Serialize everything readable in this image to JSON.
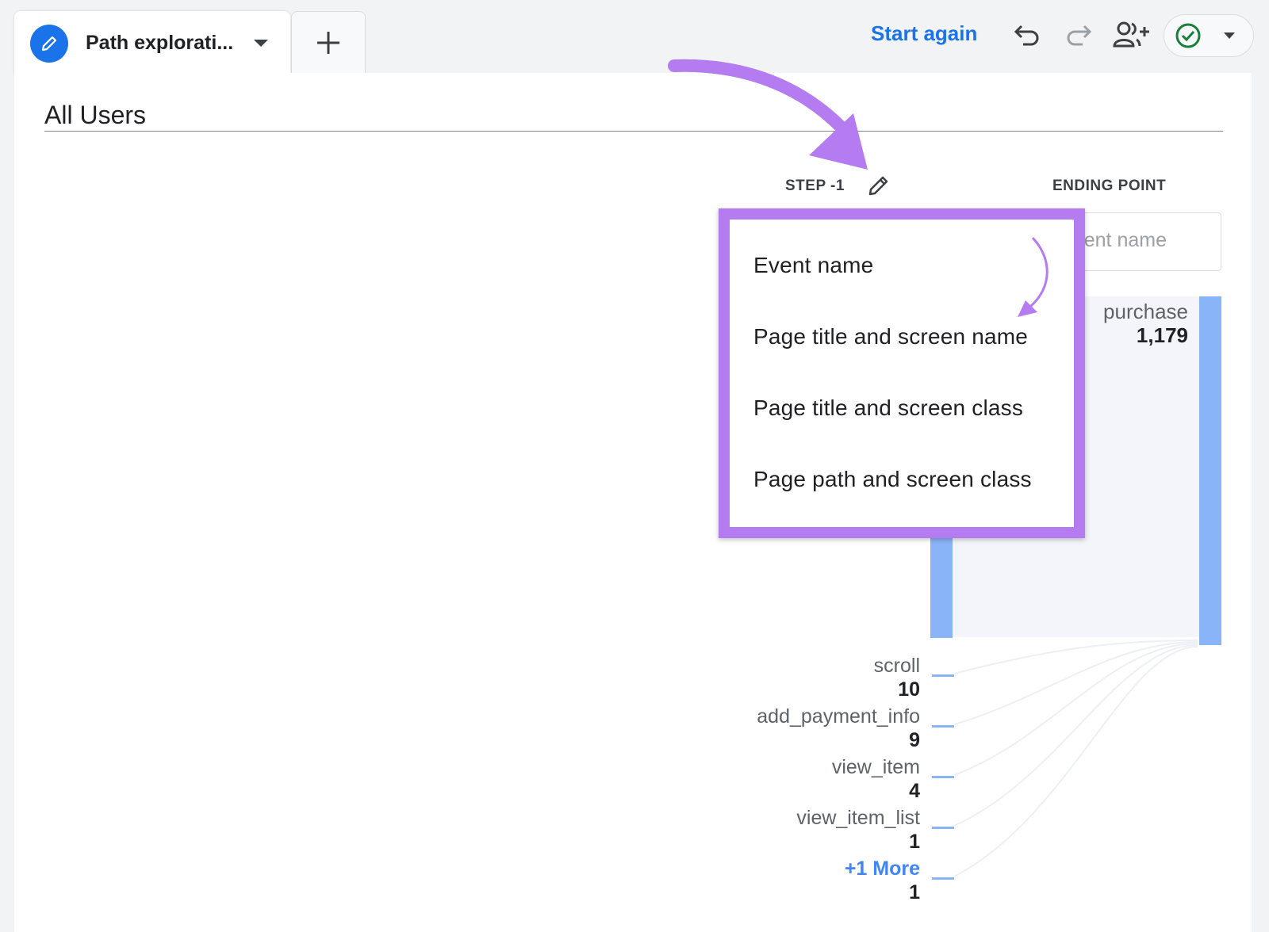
{
  "tab": {
    "label": "Path explorati...",
    "edit_icon": "pencil-icon",
    "caret_icon": "caret-down-icon"
  },
  "add_tab": {
    "icon": "plus-icon"
  },
  "toolbar": {
    "start_again": "Start again",
    "icons": [
      "undo-icon",
      "redo-icon",
      "share-users-icon",
      "check-circle-icon",
      "caret-down-icon"
    ],
    "status_color": "#188038"
  },
  "segment": {
    "title": "All Users"
  },
  "columns": {
    "step_label": "STEP -1",
    "ending_label": "ENDING POINT",
    "ending_input_value": "ent name"
  },
  "dropdown": {
    "items": [
      "Event name",
      "Page title and screen name",
      "Page title and screen class",
      "Page path and screen class"
    ]
  },
  "ending_node": {
    "name": "purchase",
    "count": "1,179"
  },
  "step_nodes": [
    {
      "name": "scroll",
      "count": "10"
    },
    {
      "name": "add_payment_info",
      "count": "9"
    },
    {
      "name": "view_item",
      "count": "4"
    },
    {
      "name": "view_item_list",
      "count": "1"
    },
    {
      "name": "+1 More",
      "count": "1"
    }
  ],
  "colors": {
    "accent": "#1a73e8",
    "bar": "#8ab4f8",
    "highlight": "#b57bf0"
  }
}
